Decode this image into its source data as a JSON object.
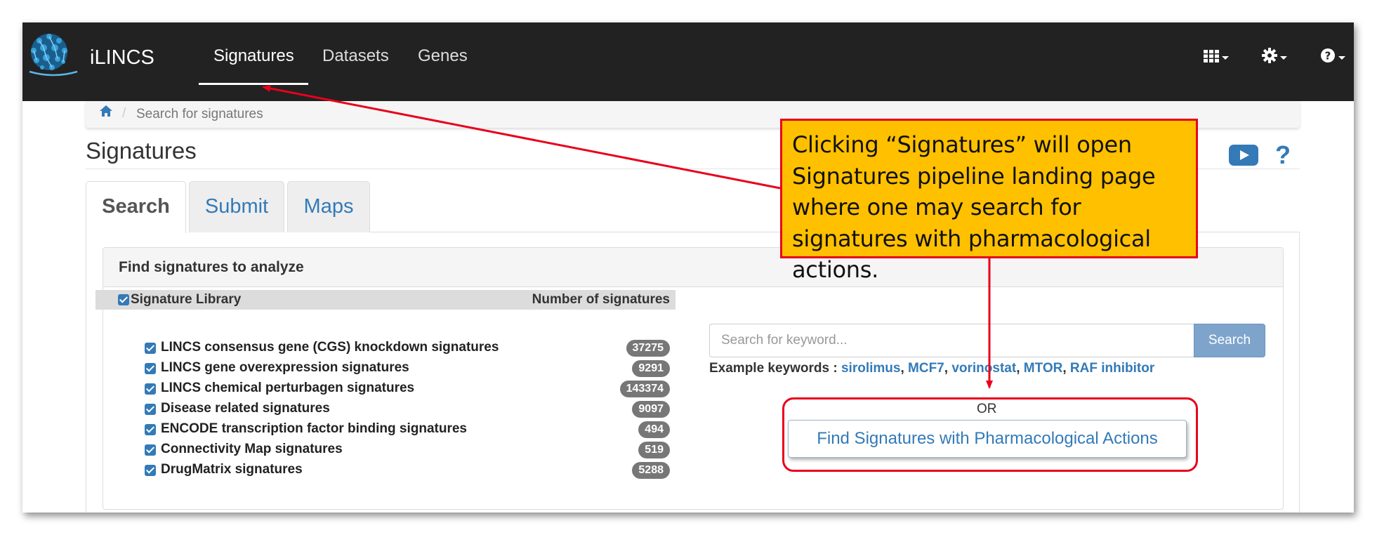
{
  "navbar": {
    "brand": "iLINCS",
    "tabs": [
      "Signatures",
      "Datasets",
      "Genes"
    ],
    "active_tab": "Signatures"
  },
  "breadcrumb": {
    "current": "Search for signatures"
  },
  "page": {
    "title": "Signatures",
    "help": "?"
  },
  "tabs": {
    "search": "Search",
    "submit": "Submit",
    "maps": "Maps",
    "active": "Search"
  },
  "panel": {
    "title": "Find signatures to analyze"
  },
  "library": {
    "header_label": "Signature Library",
    "count_header": "Number of signatures",
    "rows": [
      {
        "label": "LINCS consensus gene (CGS) knockdown signatures",
        "count": "37275",
        "checked": true
      },
      {
        "label": "LINCS gene overexpression signatures",
        "count": "9291",
        "checked": true
      },
      {
        "label": "LINCS chemical perturbagen signatures",
        "count": "143374",
        "checked": true
      },
      {
        "label": "Disease related signatures",
        "count": "9097",
        "checked": true
      },
      {
        "label": "ENCODE transcription factor binding signatures",
        "count": "494",
        "checked": true
      },
      {
        "label": "Connectivity Map signatures",
        "count": "519",
        "checked": true
      },
      {
        "label": "DrugMatrix signatures",
        "count": "5288",
        "checked": true
      }
    ]
  },
  "search": {
    "placeholder": "Search for keyword...",
    "button": "Search",
    "examples_label": "Example keywords :",
    "keywords": [
      "sirolimus",
      "MCF7",
      "vorinostat",
      "MTOR",
      "RAF inhibitor"
    ],
    "or": "OR",
    "pharm_button": "Find Signatures with Pharmacological Actions"
  },
  "annotation": {
    "callout": "Clicking “Signatures” will open Signatures pipeline landing page where one may search for signatures with pharmacological actions."
  },
  "colors": {
    "navbar": "#222222",
    "link": "#337ab7",
    "badge": "#777777",
    "callout_fill": "#ffc000",
    "annotation_red": "#e8001c"
  }
}
